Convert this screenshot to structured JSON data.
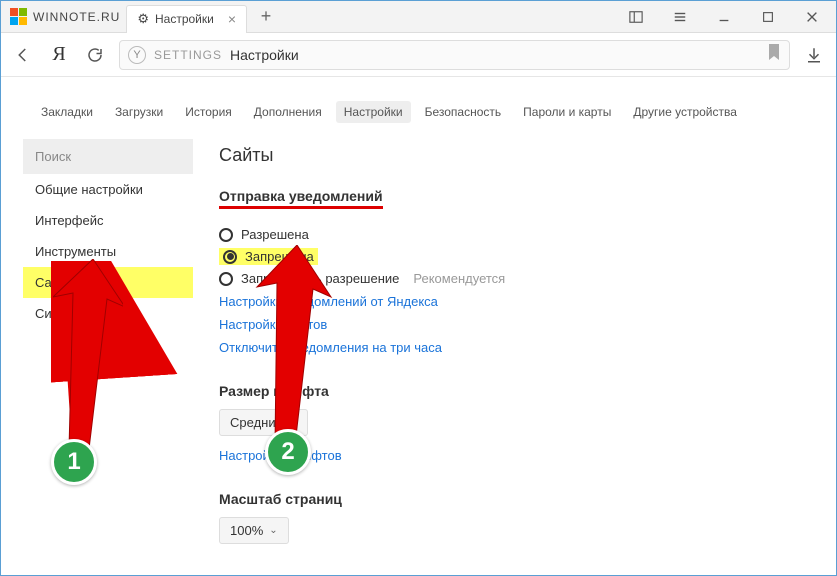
{
  "window": {
    "title": "WINNOTE.RU"
  },
  "tabs": {
    "active": {
      "label": "Настройки"
    }
  },
  "address": {
    "proto": "SETTINGS",
    "title": "Настройки"
  },
  "topnav": {
    "items": [
      "Закладки",
      "Загрузки",
      "История",
      "Дополнения",
      "Настройки",
      "Безопасность",
      "Пароли и карты",
      "Другие устройства"
    ],
    "activeIndex": 4
  },
  "sidebar": {
    "search_placeholder": "Поиск",
    "items": [
      "Общие настройки",
      "Интерфейс",
      "Инструменты",
      "Сайты",
      "Системные"
    ],
    "activeIndex": 3
  },
  "panel": {
    "heading": "Сайты",
    "notifications": {
      "title": "Отправка уведомлений",
      "opt_allowed": "Разрешена",
      "opt_denied": "Запрещена",
      "opt_ask": "Запрашивать разрешение",
      "opt_ask_rec": "Рекомендуется",
      "link_yandex": "Настройки уведомлений от Яндекса",
      "link_sites": "Настройки сайтов",
      "link_disable3h": "Отключить уведомления на три часа"
    },
    "fontsize": {
      "title": "Размер шрифта",
      "value": "Средний",
      "link_fonts": "Настройки шрифтов"
    },
    "zoom": {
      "title": "Масштаб страниц",
      "value": "100%"
    }
  },
  "annot": {
    "badge1": "1",
    "badge2": "2"
  }
}
